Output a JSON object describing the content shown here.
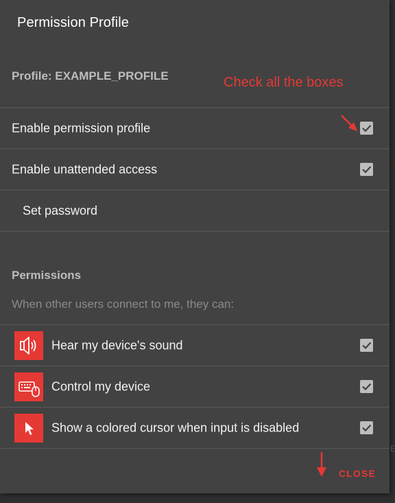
{
  "dialog": {
    "title": "Permission Profile",
    "profile_label": "Profile: EXAMPLE_PROFILE",
    "annotation": "Check all the boxes",
    "close_label": "CLOSE"
  },
  "settings": [
    {
      "label": "Enable permission profile",
      "checked": true
    },
    {
      "label": "Enable unattended access",
      "checked": true
    },
    {
      "label": "Set password"
    }
  ],
  "permissions": {
    "title": "Permissions",
    "subtitle": "When other users connect to me, they can:",
    "items": [
      {
        "label": "Hear my device's sound",
        "icon": "speaker-icon",
        "checked": true
      },
      {
        "label": "Control my device",
        "icon": "keyboard-mouse-icon",
        "checked": true
      },
      {
        "label": "Show a colored cursor when input is disabled",
        "icon": "cursor-icon",
        "checked": true
      }
    ]
  },
  "colors": {
    "accent": "#e53935",
    "dialog_bg": "#424242",
    "checkbox": "#bdbdbd"
  }
}
